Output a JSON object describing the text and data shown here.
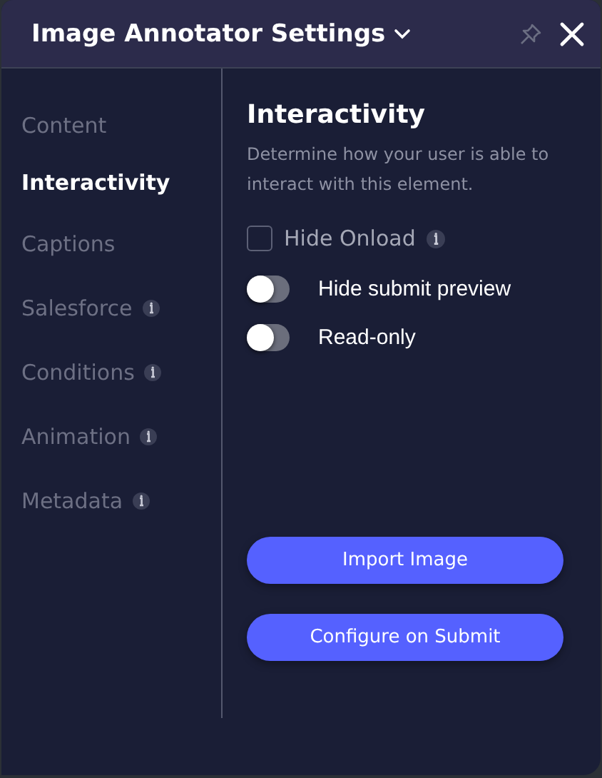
{
  "window": {
    "title": "Image Annotator Settings"
  },
  "sidebar": {
    "items": [
      {
        "label": "Content",
        "selected": false,
        "has_info": false
      },
      {
        "label": "Interactivity",
        "selected": true,
        "has_info": false
      },
      {
        "label": "Captions",
        "selected": false,
        "has_info": false
      },
      {
        "label": "Salesforce",
        "selected": false,
        "has_info": true
      },
      {
        "label": "Conditions",
        "selected": false,
        "has_info": true
      },
      {
        "label": "Animation",
        "selected": false,
        "has_info": true
      },
      {
        "label": "Metadata",
        "selected": false,
        "has_info": true
      }
    ]
  },
  "content": {
    "heading": "Interactivity",
    "description": "Determine how your user is able to interact with this element.",
    "checkbox": {
      "label": "Hide Onload",
      "checked": false,
      "has_info": true
    },
    "toggles": [
      {
        "label": "Hide submit preview",
        "on": false
      },
      {
        "label": "Read-only",
        "on": false
      }
    ],
    "buttons": [
      "Import Image",
      "Configure on Submit"
    ]
  }
}
